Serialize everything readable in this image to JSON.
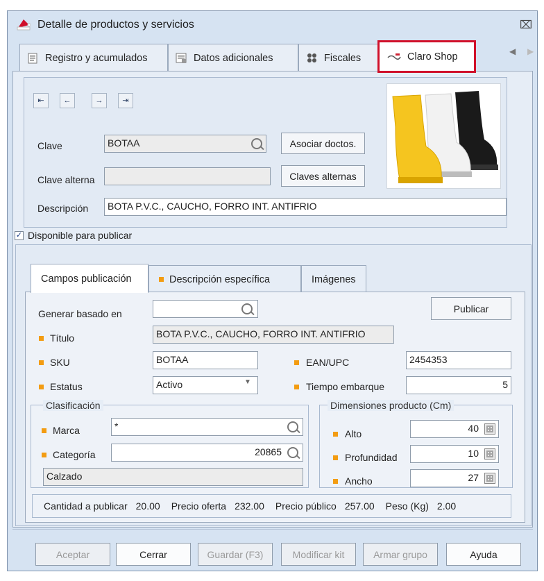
{
  "window": {
    "title": "Detalle de productos y servicios",
    "close": "⌧"
  },
  "tabs": [
    {
      "label": "Registro y acumulados",
      "icon": "register-icon"
    },
    {
      "label": "Datos adicionales",
      "icon": "data-icon"
    },
    {
      "label": "Fiscales",
      "icon": "fiscal-icon"
    },
    {
      "label": "Claro Shop",
      "icon": "claroshop-icon"
    }
  ],
  "nav": {
    "first": "⇤",
    "prev": "←",
    "next": "→",
    "last": "⇥"
  },
  "clave": {
    "label": "Clave",
    "value": "BOTAA"
  },
  "clave_alterna": {
    "label": "Clave alterna",
    "value": ""
  },
  "descripcion": {
    "label": "Descripción",
    "value": "BOTA P.V.C., CAUCHO, FORRO INT. ANTIFRIO"
  },
  "buttons": {
    "asociar": "Asociar doctos.",
    "claves_alternas": "Claves alternas"
  },
  "disponible": {
    "label": "Disponible para publicar",
    "checked": "✓"
  },
  "subtabs": [
    "Campos publicación",
    "Descripción específica",
    "Imágenes"
  ],
  "form": {
    "generar_label": "Generar basado en",
    "generar_value": "",
    "publicar": "Publicar",
    "titulo_label": "Título",
    "titulo_value": "BOTA P.V.C., CAUCHO, FORRO INT. ANTIFRIO",
    "sku_label": "SKU",
    "sku_value": "BOTAA",
    "ean_label": "EAN/UPC",
    "ean_value": "2454353",
    "estatus_label": "Estatus",
    "estatus_value": "Activo",
    "tiempo_label": "Tiempo embarque",
    "tiempo_value": "5"
  },
  "clasificacion": {
    "legend": "Clasificación",
    "marca_label": "Marca",
    "marca_value": "*",
    "categoria_label": "Categoría",
    "categoria_value": "20865",
    "categoria_name": "Calzado"
  },
  "dimensiones": {
    "legend": "Dimensiones producto (Cm)",
    "alto_label": "Alto",
    "alto_value": "40",
    "profundidad_label": "Profundidad",
    "profundidad_value": "10",
    "ancho_label": "Ancho",
    "ancho_value": "27"
  },
  "summary": {
    "cantidad_label": "Cantidad a publicar",
    "cantidad_value": "20.00",
    "oferta_label": "Precio oferta",
    "oferta_value": "232.00",
    "publico_label": "Precio público",
    "publico_value": "257.00",
    "peso_label": "Peso (Kg)",
    "peso_value": "2.00"
  },
  "footer_buttons": [
    "Aceptar",
    "Cerrar",
    "Guardar (F3)",
    "Modificar kit",
    "Armar grupo",
    "Ayuda"
  ],
  "colors": {
    "accent_orange": "#f39c12",
    "highlight_red": "#d0102a",
    "panel_blue": "#d6e3f2"
  }
}
